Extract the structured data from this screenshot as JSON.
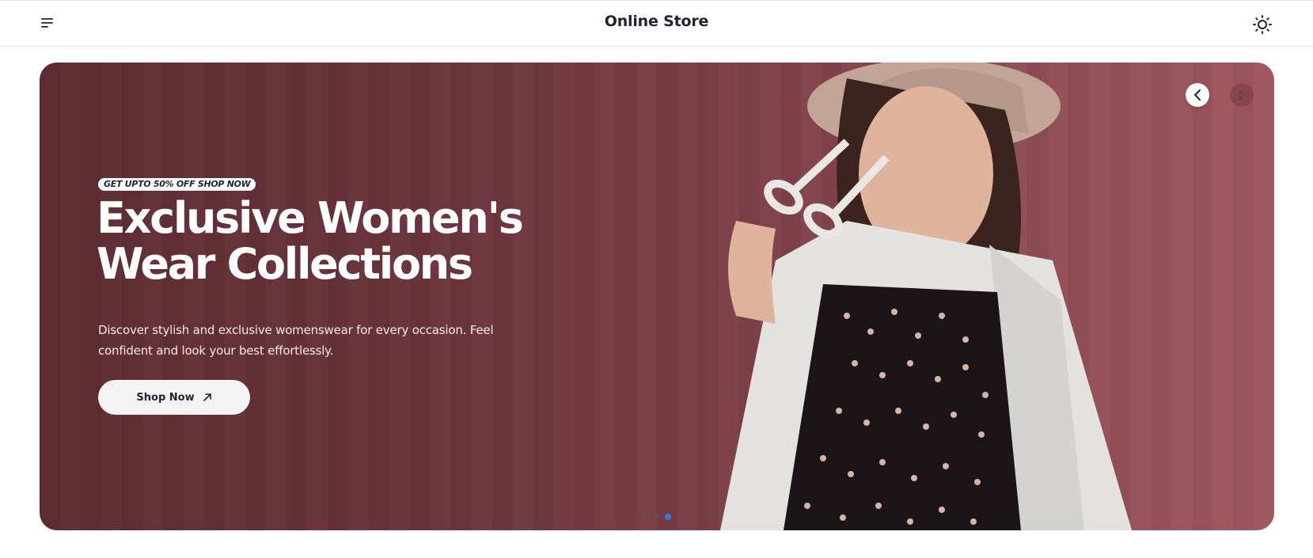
{
  "header": {
    "title": "Online Store",
    "menu_icon": "hamburger-menu-icon",
    "theme_icon": "sun-icon"
  },
  "hero": {
    "badge": "GET UPTO 50% OFF SHOP NOW",
    "headline_line1": "Exclusive Women's",
    "headline_line2": "Wear Collections",
    "description": "Discover stylish and exclusive womenswear for every occasion. Feel confident and look your best effortlessly.",
    "cta_label": "Shop Now",
    "cta_icon": "arrow-up-right-icon",
    "prev_icon": "chevron-left-icon",
    "next_icon": "chevron-right-icon",
    "slides_total": 3,
    "active_slide": 3,
    "colors": {
      "background_left": "#5e2d33",
      "background_right": "#a0575e",
      "active_dot": "#2f7be0"
    }
  }
}
